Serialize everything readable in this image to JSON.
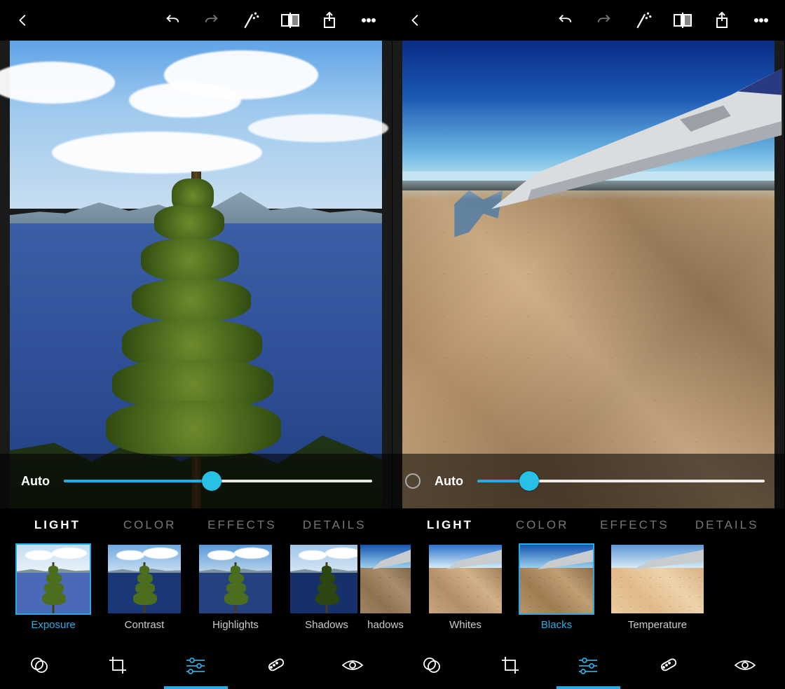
{
  "screens": [
    {
      "topbar": {
        "back": "back-icon",
        "undo": "undo-icon",
        "redo": "redo-icon",
        "autofix": "magic-wand-icon",
        "compare": "compare-split-icon",
        "share": "share-icon",
        "more": "more-horizontal-icon"
      },
      "slider": {
        "auto_label": "Auto",
        "fill_pct": 48,
        "thumb_pct": 48,
        "show_ring": false
      },
      "tabs": [
        "LIGHT",
        "COLOR",
        "EFFECTS",
        "DETAILS"
      ],
      "active_tab": "LIGHT",
      "thumbs": [
        {
          "label": "Exposure",
          "selected": true,
          "variant": "exposure"
        },
        {
          "label": "Contrast",
          "selected": false,
          "variant": "contrast"
        },
        {
          "label": "Highlights",
          "selected": false,
          "variant": "highlights"
        },
        {
          "label": "Shadows",
          "selected": false,
          "variant": "shadows"
        }
      ],
      "bottom": [
        "filters-icon",
        "crop-icon",
        "sliders-icon",
        "heal-icon",
        "eye-icon"
      ],
      "bottom_active": "sliders-icon"
    },
    {
      "topbar": {
        "back": "back-icon",
        "undo": "undo-icon",
        "redo": "redo-icon",
        "autofix": "magic-wand-icon",
        "compare": "compare-split-icon",
        "share": "share-icon",
        "more": "more-horizontal-icon"
      },
      "slider": {
        "auto_label": "Auto",
        "fill_pct": 18,
        "thumb_pct": 18,
        "show_ring": true
      },
      "tabs": [
        "LIGHT",
        "COLOR",
        "EFFECTS",
        "DETAILS"
      ],
      "active_tab": "LIGHT",
      "thumbs": [
        {
          "label": "hadows",
          "selected": false,
          "variant": "shadows"
        },
        {
          "label": "Whites",
          "selected": false,
          "variant": "whites"
        },
        {
          "label": "Blacks",
          "selected": true,
          "variant": "blacks"
        },
        {
          "label": "Temperature",
          "selected": false,
          "variant": "temperature"
        }
      ],
      "bottom": [
        "filters-icon",
        "crop-icon",
        "sliders-icon",
        "heal-icon",
        "eye-icon"
      ],
      "bottom_active": "sliders-icon"
    }
  ],
  "colors": {
    "accent": "#29abe2"
  }
}
